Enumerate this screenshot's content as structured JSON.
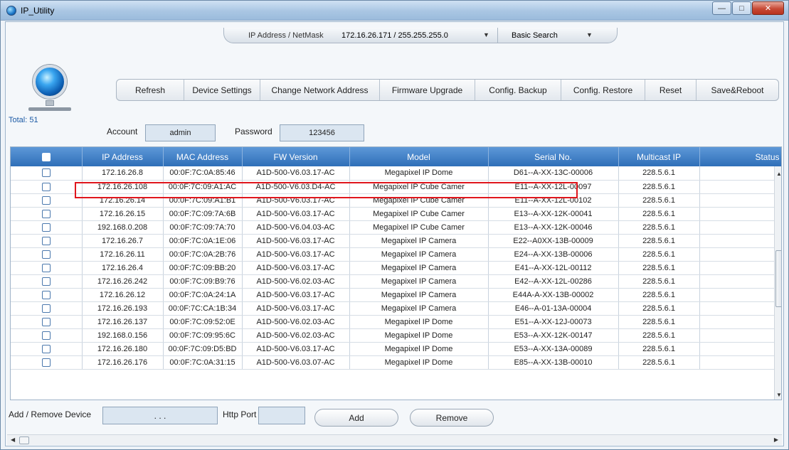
{
  "window": {
    "title": "IP_Utility"
  },
  "topbar": {
    "ipmask_label": "IP Address / NetMask",
    "ipmask_value": "172.16.26.171 / 255.255.255.0",
    "search_mode": "Basic Search"
  },
  "toolbar": {
    "buttons": [
      "Refresh",
      "Device Settings",
      "Change Network Address",
      "Firmware Upgrade",
      "Config. Backup",
      "Config. Restore",
      "Reset",
      "Save&Reboot"
    ]
  },
  "summary": {
    "total": "Total: 51"
  },
  "credentials": {
    "account_label": "Account",
    "account_value": "admin",
    "password_label": "Password",
    "password_value": "123456"
  },
  "table": {
    "columns": [
      "IP Address",
      "MAC Address",
      "FW Version",
      "Model",
      "Serial No.",
      "Multicast IP",
      "Status"
    ],
    "rows": [
      [
        "172.16.26.8",
        "00:0F:7C:0A:85:46",
        "A1D-500-V6.03.17-AC",
        "Megapixel IP Dome",
        "D61--A-XX-13C-00006",
        "228.5.6.1",
        ""
      ],
      [
        "172.16.26.108",
        "00:0F:7C:09:A1:AC",
        "A1D-500-V6.03.D4-AC",
        "Megapixel IP Cube Camer",
        "E11--A-XX-12L-00097",
        "228.5.6.1",
        ""
      ],
      [
        "172.16.26.14",
        "00:0F:7C:09:A1:B1",
        "A1D-500-V6.03.17-AC",
        "Megapixel IP Cube Camer",
        "E11--A-XX-12L-00102",
        "228.5.6.1",
        ""
      ],
      [
        "172.16.26.15",
        "00:0F:7C:09:7A:6B",
        "A1D-500-V6.03.17-AC",
        "Megapixel IP Cube Camer",
        "E13--A-XX-12K-00041",
        "228.5.6.1",
        ""
      ],
      [
        "192.168.0.208",
        "00:0F:7C:09:7A:70",
        "A1D-500-V6.04.03-AC",
        "Megapixel IP Cube Camer",
        "E13--A-XX-12K-00046",
        "228.5.6.1",
        ""
      ],
      [
        "172.16.26.7",
        "00:0F:7C:0A:1E:06",
        "A1D-500-V6.03.17-AC",
        "Megapixel IP Camera",
        "E22--A0XX-13B-00009",
        "228.5.6.1",
        ""
      ],
      [
        "172.16.26.11",
        "00:0F:7C:0A:2B:76",
        "A1D-500-V6.03.17-AC",
        "Megapixel IP Camera",
        "E24--A-XX-13B-00006",
        "228.5.6.1",
        ""
      ],
      [
        "172.16.26.4",
        "00:0F:7C:09:BB:20",
        "A1D-500-V6.03.17-AC",
        "Megapixel IP Camera",
        "E41--A-XX-12L-00112",
        "228.5.6.1",
        ""
      ],
      [
        "172.16.26.242",
        "00:0F:7C:09:B9:76",
        "A1D-500-V6.02.03-AC",
        "Megapixel IP Camera",
        "E42--A-XX-12L-00286",
        "228.5.6.1",
        ""
      ],
      [
        "172.16.26.12",
        "00:0F:7C:0A:24:1A",
        "A1D-500-V6.03.17-AC",
        "Megapixel IP Camera",
        "E44A-A-XX-13B-00002",
        "228.5.6.1",
        ""
      ],
      [
        "172.16.26.193",
        "00:0F:7C:CA:1B:34",
        "A1D-500-V6.03.17-AC",
        "Megapixel IP Camera",
        "E46--A-01-13A-00004",
        "228.5.6.1",
        ""
      ],
      [
        "172.16.26.137",
        "00:0F:7C:09:52:0E",
        "A1D-500-V6.02.03-AC",
        "Megapixel IP Dome",
        "E51--A-XX-12J-00073",
        "228.5.6.1",
        ""
      ],
      [
        "192.168.0.156",
        "00:0F:7C:09:95:6C",
        "A1D-500-V6.02.03-AC",
        "Megapixel IP Dome",
        "E53--A-XX-12K-00147",
        "228.5.6.1",
        ""
      ],
      [
        "172.16.26.180",
        "00:0F:7C:09:D5:BD",
        "A1D-500-V6.03.17-AC",
        "Megapixel IP Dome",
        "E53--A-XX-13A-00089",
        "228.5.6.1",
        ""
      ],
      [
        "172.16.26.176",
        "00:0F:7C:0A:31:15",
        "A1D-500-V6.03.07-AC",
        "Megapixel IP Dome",
        "E85--A-XX-13B-00010",
        "228.5.6.1",
        ""
      ]
    ]
  },
  "add_device": {
    "label": "Add / Remove Device",
    "ip_placeholder": ".     .     .",
    "http_port_label": "Http Port",
    "add_button": "Add",
    "remove_button": "Remove"
  },
  "colors": {
    "header_blue": "#3b7cc4",
    "highlight_red": "#e0161d",
    "input_bg": "#dbe6f1"
  }
}
